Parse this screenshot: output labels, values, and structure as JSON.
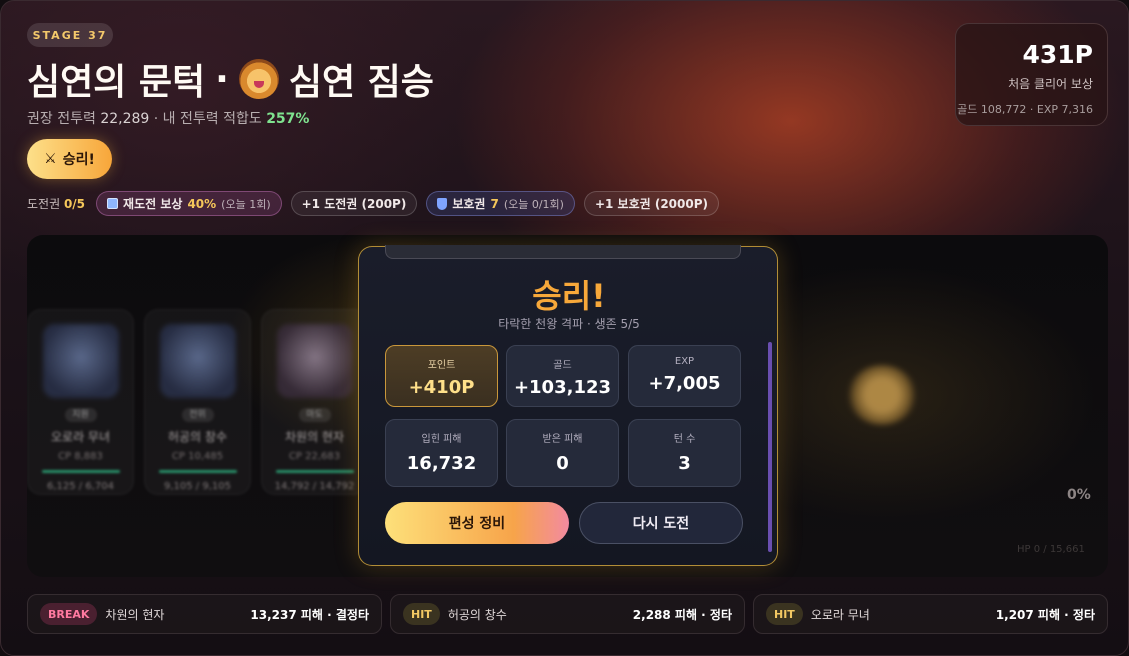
{
  "header": {
    "stage_chip": "STAGE 37",
    "title_left": "심연의 문턱",
    "title_sep": "·",
    "title_boss": "심연 짐승",
    "title_icon": "lion-face-emoji",
    "recommended_label": "권장 전투력",
    "recommended_power": "22,289",
    "my_power_label": "· 내 전투력 적합도",
    "fit_percent": "257%"
  },
  "result_pill": {
    "icon": "crossed-swords",
    "label": "승리!"
  },
  "first_clear_reward": {
    "points": "431P",
    "label": "처음 클리어 보상",
    "detail": "골드 108,772 · EXP 7,316"
  },
  "tickets": {
    "label": "도전권",
    "count": "0/5",
    "retry_reward_label": "재도전 보상",
    "retry_reward_value": "40%",
    "retry_reward_note": "(오늘 1회)",
    "buy_ticket": "+1 도전권 (200P)",
    "shield_label": "보호권",
    "shield_count": "7",
    "shield_note": "(오늘 0/1회)",
    "buy_shield": "+1 보호권 (2000P)"
  },
  "heroes": [
    {
      "role": "지원",
      "name": "오로라 무녀",
      "cp": "CP 8,883",
      "hp": "6,125 / 6,704"
    },
    {
      "role": "전위",
      "name": "허공의 창수",
      "cp": "CP 10,485",
      "hp": "9,105 / 9,105"
    },
    {
      "role": "마도",
      "name": "차원의 현자",
      "cp": "CP 22,683",
      "hp": "14,792 / 14,792"
    }
  ],
  "boss": {
    "hp_percent": "0%",
    "hp_text": "HP 0 / 15,661"
  },
  "modal": {
    "title": "승리!",
    "subtitle": "타락한 천왕 격파 · 생존 5/5",
    "stats": [
      {
        "label": "포인트",
        "value": "+410P"
      },
      {
        "label": "골드",
        "value": "+103,123"
      },
      {
        "label": "EXP",
        "value": "+7,005"
      },
      {
        "label": "입힌 피해",
        "value": "16,732"
      },
      {
        "label": "받은 피해",
        "value": "0"
      },
      {
        "label": "턴 수",
        "value": "3"
      }
    ],
    "primary_button": "편성 정비",
    "secondary_button": "다시 도전"
  },
  "battle_log": [
    {
      "badge": "BREAK",
      "name": "차원의 현자",
      "damage": "13,237 피해 · 결정타"
    },
    {
      "badge": "HIT",
      "name": "허공의 창수",
      "damage": "2,288 피해 · 정타"
    },
    {
      "badge": "HIT",
      "name": "오로라 무녀",
      "damage": "1,207 피해 · 정타"
    }
  ],
  "colors": {
    "accent_gold": "#f7a83a",
    "fit_green": "#7fe38f",
    "break_pink": "#ff7aa0"
  }
}
